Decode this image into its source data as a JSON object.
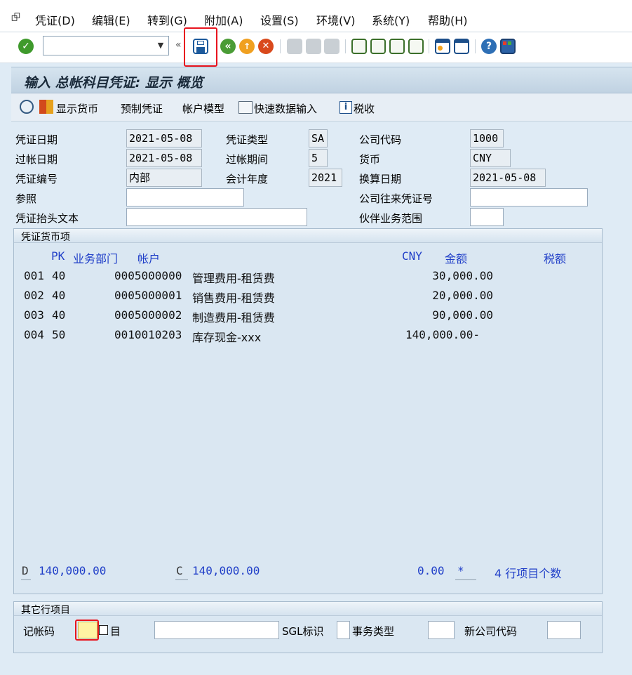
{
  "menu": {
    "items": [
      "凭证(D)",
      "编辑(E)",
      "转到(G)",
      "附加(A)",
      "设置(S)",
      "环境(V)",
      "系统(Y)",
      "帮助(H)"
    ]
  },
  "toolbar": {
    "command_value": "",
    "icons": [
      "enter-icon",
      "save-icon",
      "back-icon",
      "exit-icon",
      "cancel-icon",
      "print-icon",
      "find-icon",
      "find-next-icon",
      "first-page-icon",
      "prev-page-icon",
      "next-page-icon",
      "last-page-icon",
      "new-session-icon",
      "shortcut-icon",
      "help-icon",
      "layout-icon"
    ]
  },
  "screen": {
    "title": "输入 总帐科目凭证: 显示 概览"
  },
  "app_toolbar": {
    "show_currency": "显示货币",
    "park_document": "预制凭证",
    "account_model": "帐户模型",
    "fast_entry": "快速数据输入",
    "taxes": "税收"
  },
  "header": {
    "doc_date_label": "凭证日期",
    "doc_date": "2021-05-08",
    "doc_type_label": "凭证类型",
    "doc_type": "SA",
    "company_code_label": "公司代码",
    "company_code": "1000",
    "posting_date_label": "过帐日期",
    "posting_date": "2021-05-08",
    "period_label": "过帐期间",
    "period": "5",
    "currency_label": "货币",
    "currency": "CNY",
    "doc_number_label": "凭证编号",
    "doc_number": "内部",
    "fiscal_year_label": "会计年度",
    "fiscal_year": "2021",
    "translation_date_label": "换算日期",
    "translation_date": "2021-05-08",
    "reference_label": "参照",
    "reference": "",
    "cross_cc_label": "公司往来凭证号",
    "cross_cc": "",
    "header_text_label": "凭证抬头文本",
    "header_text": "",
    "trading_partner_label": "伙伴业务范围",
    "trading_partner": ""
  },
  "items_frame": {
    "title": "凭证货币项",
    "columns": {
      "pk": "PK",
      "bus_area": "业务部门",
      "account": "帐户",
      "currency": "CNY",
      "amount": "金额",
      "tax": "税额"
    },
    "rows": [
      {
        "no": "001",
        "pk": "40",
        "account": "0005000000",
        "text": "管理费用-租赁费",
        "amount": "30,000.00"
      },
      {
        "no": "002",
        "pk": "40",
        "account": "0005000001",
        "text": "销售费用-租赁费",
        "amount": "20,000.00"
      },
      {
        "no": "003",
        "pk": "40",
        "account": "0005000002",
        "text": "制造费用-租赁费",
        "amount": "90,000.00"
      },
      {
        "no": "004",
        "pk": "50",
        "account": "0010010203",
        "text": "库存现金-xxx",
        "amount": "140,000.00-"
      }
    ],
    "totals": {
      "debit_label": "D",
      "debit": "140,000.00",
      "credit_label": "C",
      "credit": "140,000.00",
      "balance": "0.00",
      "balance_flag": "*",
      "item_count": "4 行项目个数"
    }
  },
  "other_frame": {
    "title": "其它行项目",
    "posting_key_label": "记帐码",
    "posting_key": "",
    "account_label": "目",
    "account": "",
    "sgl_label": "SGL标识",
    "sgl": "",
    "trans_type_label": "事务类型",
    "trans_type": "",
    "new_cc_label": "新公司代码",
    "new_cc": ""
  },
  "colors": {
    "accent_blue": "#1f3ec8",
    "highlight_red": "#e8141e",
    "posting_key_bg": "#fff3a3"
  }
}
